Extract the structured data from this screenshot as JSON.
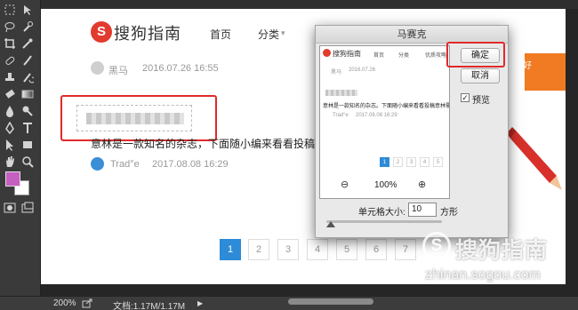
{
  "page": {
    "header": {
      "logo_letter": "S",
      "brand": "搜狗指南",
      "nav": [
        "首页",
        "分类"
      ],
      "nav_caret": "▾"
    },
    "post_1": {
      "author": "黑马",
      "date": "2016.07.26 16:55"
    },
    "post_2": {
      "text": "意林是一款知名的杂志，下面随小编来看看投稿意林",
      "author": "Trad°e",
      "date": "2017.08.08 16:29"
    },
    "banner_text": "手好",
    "pagination": [
      "1",
      "2",
      "3",
      "4",
      "5",
      "6",
      "7"
    ],
    "pagination_active": "1"
  },
  "dialog": {
    "title": "马赛克",
    "ok_label": "确定",
    "cancel_label": "取消",
    "preview_checkbox_label": "预览",
    "preview_checked": true,
    "check_glyph": "✓",
    "zoom_out_icon": "⊖",
    "zoom_in_icon": "⊕",
    "zoom_level": "100%",
    "cell_size_label": "单元格大小:",
    "cell_size_value": "10",
    "cell_size_unit": "方形",
    "preview": {
      "brand": "搜狗指南",
      "nav": [
        "首页",
        "分类",
        "优质攻略"
      ],
      "author_1": "黑马",
      "date_1": "2016.07.26",
      "body_text": "意林是一款知名的杂志。下面随小编来看看投稿意林需要",
      "author_2": "Trad°e",
      "date_2": "2017.08.08 16:29",
      "pagination": [
        "1",
        "2",
        "3",
        "4",
        "5"
      ],
      "pagination_active": "1"
    }
  },
  "statusbar": {
    "zoom": "200%",
    "doc_info": "文档:1.17M/1.17M",
    "arrow": "▶"
  },
  "watermark": {
    "logo_letter": "S",
    "text": "搜狗指南",
    "url": "zhinan.sogou.com"
  },
  "colors": {
    "accent_red": "#e02a2a",
    "page_active_blue": "#2d8bd8",
    "foreground_swatch": "#c55fc0"
  }
}
